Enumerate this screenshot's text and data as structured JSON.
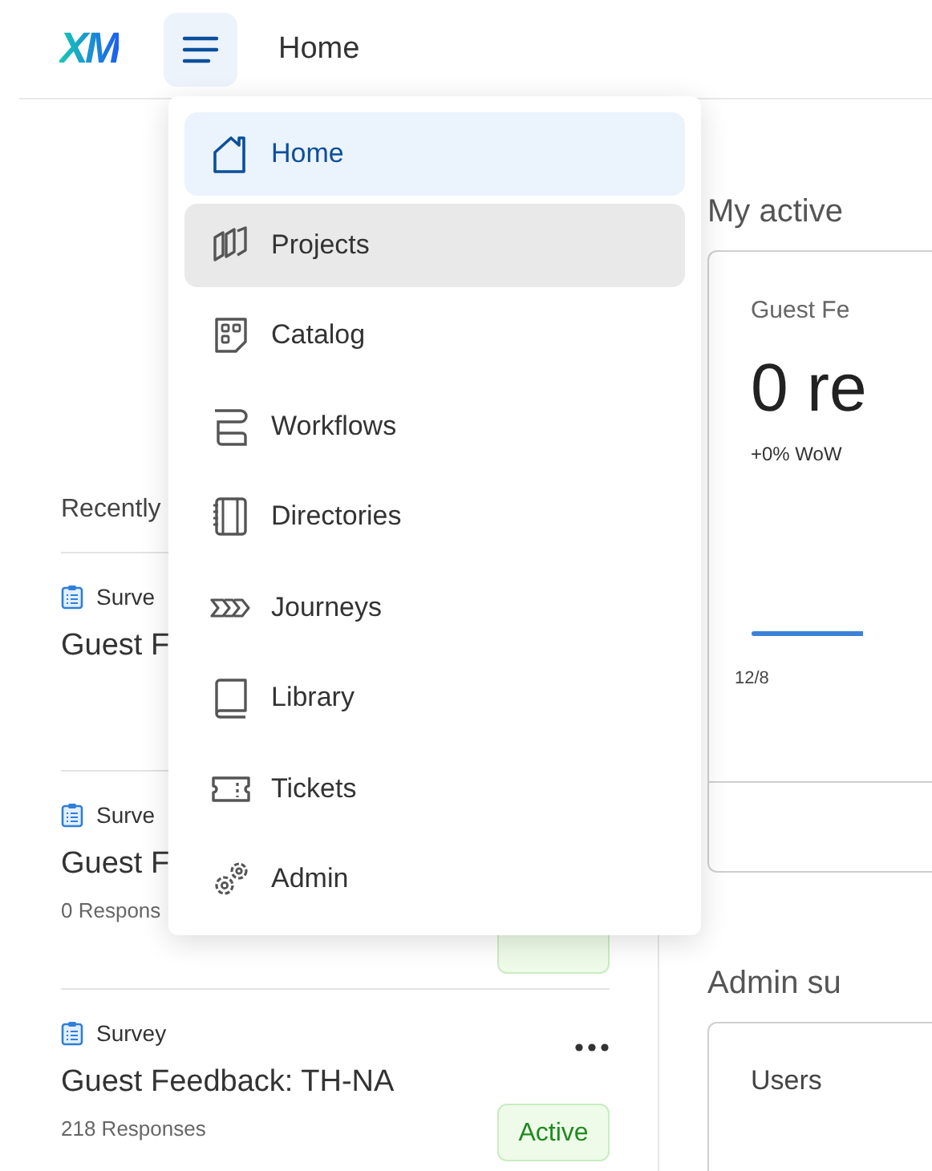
{
  "header": {
    "logo": "XM",
    "menu_open": true,
    "title": "Home"
  },
  "menu": {
    "items": [
      {
        "label": "Home",
        "kind": "home",
        "selected": true,
        "hovered": false
      },
      {
        "label": "Projects",
        "kind": "projects",
        "selected": false,
        "hovered": true
      },
      {
        "label": "Catalog",
        "kind": "catalog",
        "selected": false,
        "hovered": false
      },
      {
        "label": "Workflows",
        "kind": "workflows",
        "selected": false,
        "hovered": false
      },
      {
        "label": "Directories",
        "kind": "directories",
        "selected": false,
        "hovered": false
      },
      {
        "label": "Journeys",
        "kind": "journeys",
        "selected": false,
        "hovered": false
      },
      {
        "label": "Library",
        "kind": "library",
        "selected": false,
        "hovered": false
      },
      {
        "label": "Tickets",
        "kind": "tickets",
        "selected": false,
        "hovered": false
      },
      {
        "label": "Admin",
        "kind": "admin",
        "selected": false,
        "hovered": false
      }
    ]
  },
  "recent": {
    "heading": "Recently",
    "rows": [
      {
        "type": "Surve",
        "name": "Guest F"
      },
      {
        "type": "Surve",
        "name": "Guest F",
        "responses": "0 Respons",
        "has_badge": true
      },
      {
        "type": "Survey",
        "name": "Guest Feedback: TH-NA",
        "responses": "218 Responses",
        "has_badge": true,
        "badge": "Active",
        "more": true
      }
    ]
  },
  "active": {
    "heading": "My active",
    "card": {
      "title": "Guest Fe",
      "value": "0 re",
      "change": "+0% WoW",
      "date": "12/8"
    }
  },
  "admin": {
    "heading": "Admin su",
    "card": {
      "title": "Users"
    }
  }
}
